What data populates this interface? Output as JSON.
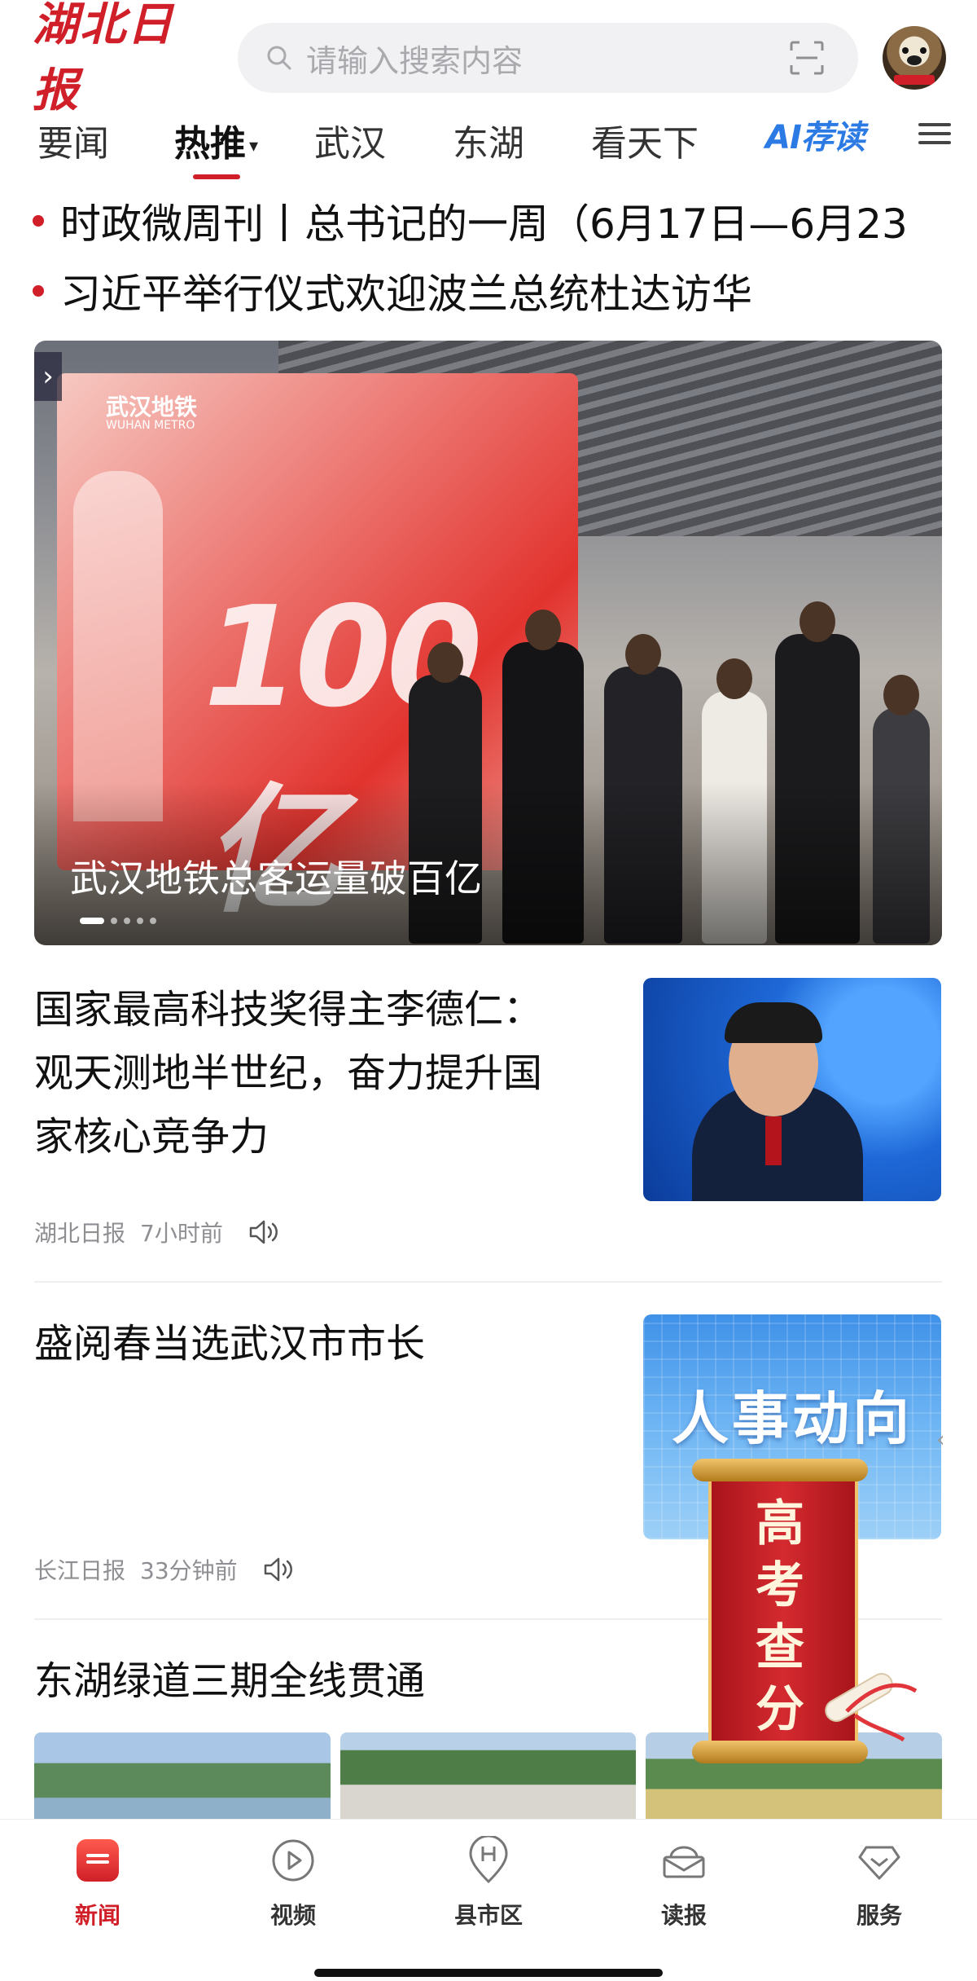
{
  "header": {
    "logo_text": "湖北日报",
    "search_placeholder": "请输入搜索内容"
  },
  "tabs": [
    {
      "label": "要闻"
    },
    {
      "label": "热推",
      "active": true
    },
    {
      "label": "武汉"
    },
    {
      "label": "东湖"
    },
    {
      "label": "看天下"
    },
    {
      "label": "AI荐读"
    }
  ],
  "headlines": [
    {
      "text": "时政微周刊丨总书记的一周（6月17日—6月23"
    },
    {
      "text": "习近平举行仪式欢迎波兰总统杜达访华"
    }
  ],
  "banner": {
    "caption": "武汉地铁总客运量破百亿",
    "ad_logo": "武汉地铁",
    "ad_sub": "WUHAN METRO",
    "ad_number": "100亿",
    "slide_count": 5,
    "active_slide": 1
  },
  "news": [
    {
      "title_lines": [
        "国家最高科技奖得主李德仁：",
        "观天测地半世纪，奋力提升国",
        "家核心竞争力"
      ],
      "source": "湖北日报",
      "time": "7小时前"
    },
    {
      "title_lines": [
        "盛阅春当选武汉市市长"
      ],
      "source": "长江日报",
      "time": "33分钟前",
      "thumb_text": "人事动向"
    },
    {
      "title_lines": [
        "东湖绿道三期全线贯通"
      ]
    }
  ],
  "scroll_banner": {
    "lines": [
      "高",
      "考",
      "查",
      "分"
    ]
  },
  "bottom_nav": [
    {
      "label": "新闻",
      "icon": "news-icon",
      "active": true
    },
    {
      "label": "视频",
      "icon": "video-icon"
    },
    {
      "label": "县市区",
      "icon": "county-icon"
    },
    {
      "label": "读报",
      "icon": "newspaper-icon"
    },
    {
      "label": "服务",
      "icon": "service-icon"
    }
  ],
  "colors": {
    "brand_red": "#d01f28",
    "ai_blue": "#2c7be5"
  }
}
